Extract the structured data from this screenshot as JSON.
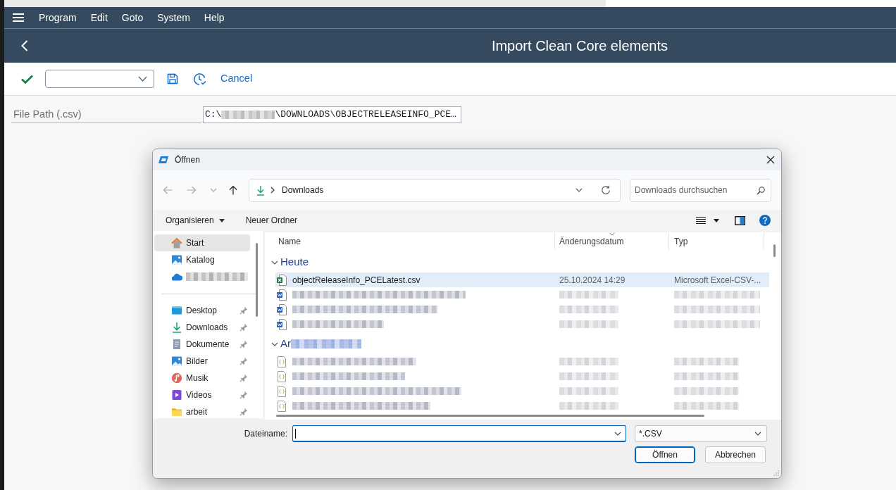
{
  "sap_window": {
    "menu_bar": [
      {
        "label": "Program"
      },
      {
        "label": "Edit"
      },
      {
        "label": "Goto"
      },
      {
        "label": "System"
      },
      {
        "label": "Help"
      }
    ],
    "title": "Import Clean Core elements",
    "toolbar": {
      "cancel": "Cancel"
    },
    "form": [
      {
        "label": "File Path (.csv)",
        "value_start": "C:\\",
        "value_redacted": true,
        "value_end": "\\DOWNLOADS\\OBJECTRELEASEINFO_PCE…"
      }
    ]
  },
  "dialog": {
    "title": "Öffnen",
    "nav_buttons": [
      {
        "kind": "back",
        "disabled": true
      },
      {
        "kind": "forward",
        "disabled": true
      },
      {
        "kind": "recent",
        "disabled": true
      },
      {
        "kind": "up",
        "disabled": false
      }
    ],
    "address": {
      "location": "Downloads"
    },
    "search": {
      "placeholder": "Downloads durchsuchen"
    },
    "commands": [
      {
        "label": "Organisieren",
        "dropdown": true
      },
      {
        "label": "Neuer Ordner",
        "dropdown": false
      }
    ],
    "nav_pane": [
      {
        "kind": "home",
        "label": "Start",
        "selected": true,
        "pinned": false
      },
      {
        "kind": "gallery",
        "label": "Katalog",
        "selected": false,
        "pinned": false
      },
      {
        "kind": "cloud",
        "redacted": true,
        "selected": false,
        "pinned": false
      },
      {
        "kind": "separator"
      },
      {
        "kind": "desktop",
        "label": "Desktop",
        "selected": false,
        "pinned": true
      },
      {
        "kind": "downloads",
        "label": "Downloads",
        "selected": false,
        "pinned": true
      },
      {
        "kind": "documents",
        "label": "Dokumente",
        "selected": false,
        "pinned": true
      },
      {
        "kind": "pictures",
        "label": "Bilder",
        "selected": false,
        "pinned": true
      },
      {
        "kind": "music",
        "label": "Musik",
        "selected": false,
        "pinned": true
      },
      {
        "kind": "videos",
        "label": "Videos",
        "selected": false,
        "pinned": true
      },
      {
        "kind": "folder",
        "label": "arbeit",
        "selected": false,
        "pinned": true
      }
    ],
    "file_list": {
      "columns": [
        {
          "label": "Name",
          "sorted": false
        },
        {
          "label": "Änderungsdatum",
          "sorted": true
        },
        {
          "label": "Typ",
          "sorted": false
        }
      ],
      "groups": [
        {
          "title": "Heute",
          "expanded": true,
          "rows": [
            {
              "kind": "excel",
              "name": "objectReleaseInfo_PCELatest.csv",
              "modified": "25.10.2024 14:29",
              "type": "Microsoft Excel-CSV-...",
              "selected": true
            },
            {
              "kind": "word",
              "redacted": true,
              "selected": false
            },
            {
              "kind": "word",
              "redacted": true,
              "selected": false
            },
            {
              "kind": "word",
              "redacted": true,
              "selected": false
            }
          ]
        },
        {
          "title": "Ar",
          "title_redacted": true,
          "expanded": true,
          "rows": [
            {
              "kind": "json",
              "redacted": true,
              "selected": false
            },
            {
              "kind": "json",
              "redacted": true,
              "selected": false
            },
            {
              "kind": "json",
              "redacted": true,
              "selected": false
            },
            {
              "kind": "json",
              "redacted": true,
              "selected": false
            }
          ]
        }
      ]
    },
    "file_name": {
      "label": "Dateiname:",
      "focused": true
    },
    "file_type": {
      "value": "*.CSV"
    },
    "buttons": [
      {
        "label": "Öffnen",
        "default": true
      },
      {
        "label": "Abbrechen",
        "default": false
      }
    ]
  }
}
